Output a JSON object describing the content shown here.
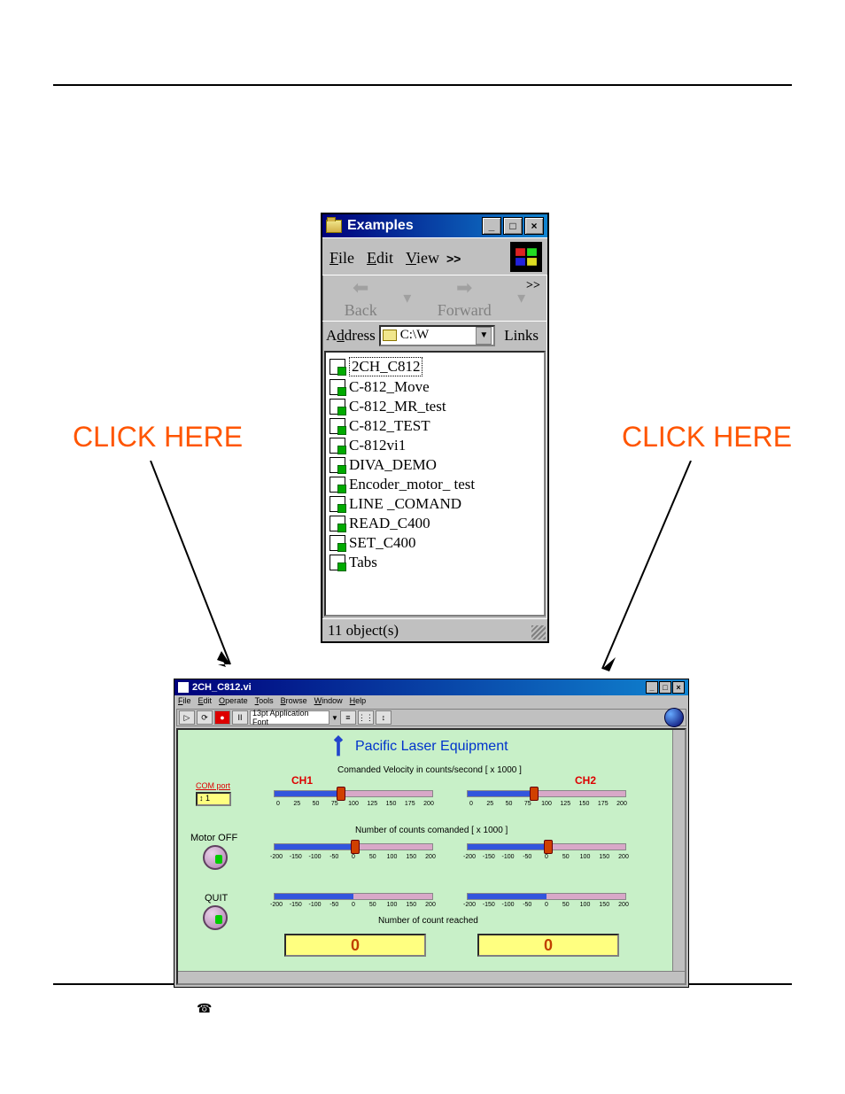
{
  "annotations": {
    "click_left": "CLICK HERE",
    "click_right": "CLICK HERE"
  },
  "explorer": {
    "title": "Examples",
    "menu": {
      "file": "File",
      "edit": "Edit",
      "view": "View",
      "more": ">>"
    },
    "nav": {
      "back": "Back",
      "forward": "Forward",
      "more": ">>"
    },
    "address_label": "Address",
    "address_value": "C:\\W",
    "links_label": "Links",
    "files": [
      "2CH_C812",
      "C-812_Move",
      "C-812_MR_test",
      "C-812_TEST",
      "C-812vi1",
      "DIVA_DEMO",
      "Encoder_motor_ test",
      "LINE _COMAND",
      "READ_C400",
      "SET_C400",
      "Tabs"
    ],
    "status": "11 object(s)"
  },
  "labview": {
    "title": "2CH_C812.vi",
    "menu": [
      "File",
      "Edit",
      "Operate",
      "Tools",
      "Browse",
      "Window",
      "Help"
    ],
    "font_box": "13pt Application Font",
    "company": "Pacific Laser Equipment",
    "velocity_label": "Comanded Velocity in counts/second [ x 1000 ]",
    "counts_cmd_label": "Number of counts comanded [ x 1000 ]",
    "counts_reached_label": "Number of count reached",
    "ch1": "CH1",
    "ch2": "CH2",
    "com_port_label": "COM port",
    "com_port_value": "1",
    "motor_off_label": "Motor OFF",
    "quit_label": "QUIT",
    "velocity_ticks": [
      "0",
      "25",
      "50",
      "75",
      "100",
      "125",
      "150",
      "175",
      "200"
    ],
    "counts_ticks": [
      "-200",
      "-150",
      "-100",
      "-50",
      "0",
      "50",
      "100",
      "150",
      "200"
    ],
    "readout_ch1": "0",
    "readout_ch2": "0"
  }
}
